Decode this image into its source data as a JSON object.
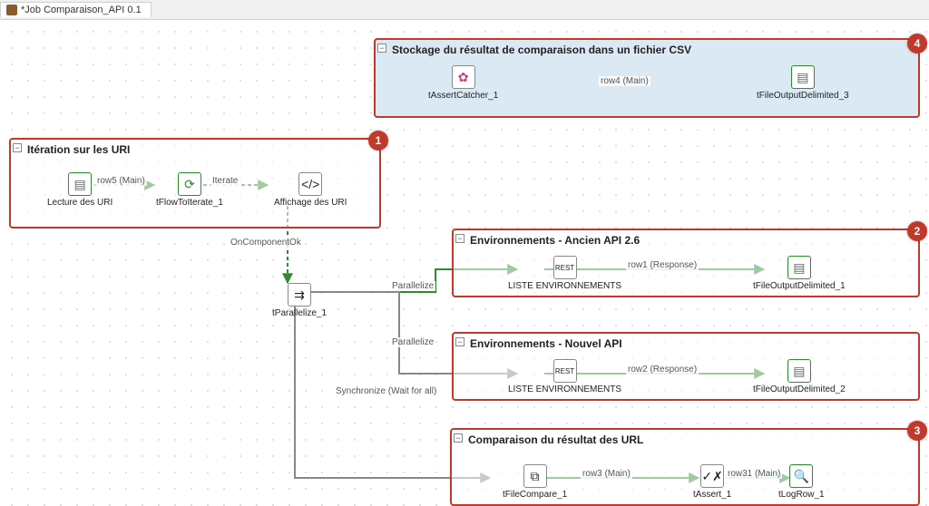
{
  "tab": {
    "title": "*Job Comparaison_API 0.1"
  },
  "subjobs": {
    "storage": {
      "title": "Stockage du résultat de comparaison dans un fichier CSV",
      "components": {
        "assertCatcher": "tAssertCatcher_1",
        "fileOut": "tFileOutputDelimited_3"
      },
      "link": "row4 (Main)"
    },
    "iteration": {
      "title": "Itération sur les URI",
      "components": {
        "read": "Lecture des URI",
        "flow": "tFlowToIterate_1",
        "disp": "Affichage des URI"
      },
      "links": {
        "row5": "row5 (Main)",
        "iterate": "Iterate"
      }
    },
    "ancien": {
      "title": "Environnements - Ancien API 2.6",
      "components": {
        "rest": "LISTE ENVIRONNEMENTS",
        "out": "tFileOutputDelimited_1"
      },
      "link": "row1 (Response)"
    },
    "nouvel": {
      "title": "Environnements - Nouvel API",
      "components": {
        "rest": "LISTE ENVIRONNEMENTS",
        "out": "tFileOutputDelimited_2"
      },
      "link": "row2 (Response)"
    },
    "compare": {
      "title": "Comparaison du résultat des URL",
      "components": {
        "fc": "tFileCompare_1",
        "assert": "tAssert_1",
        "log": "tLogRow_1"
      },
      "links": {
        "row3": "row3 (Main)",
        "row31": "row31 (Main)"
      }
    }
  },
  "connectors": {
    "onCompOk": "OnComponentOk",
    "parallelize": "Parallelize",
    "sync": "Synchronize (Wait for all)"
  },
  "parallelize": "tParallelize_1",
  "badges": {
    "b1": "1",
    "b2": "2",
    "b3": "3",
    "b4": "4"
  }
}
